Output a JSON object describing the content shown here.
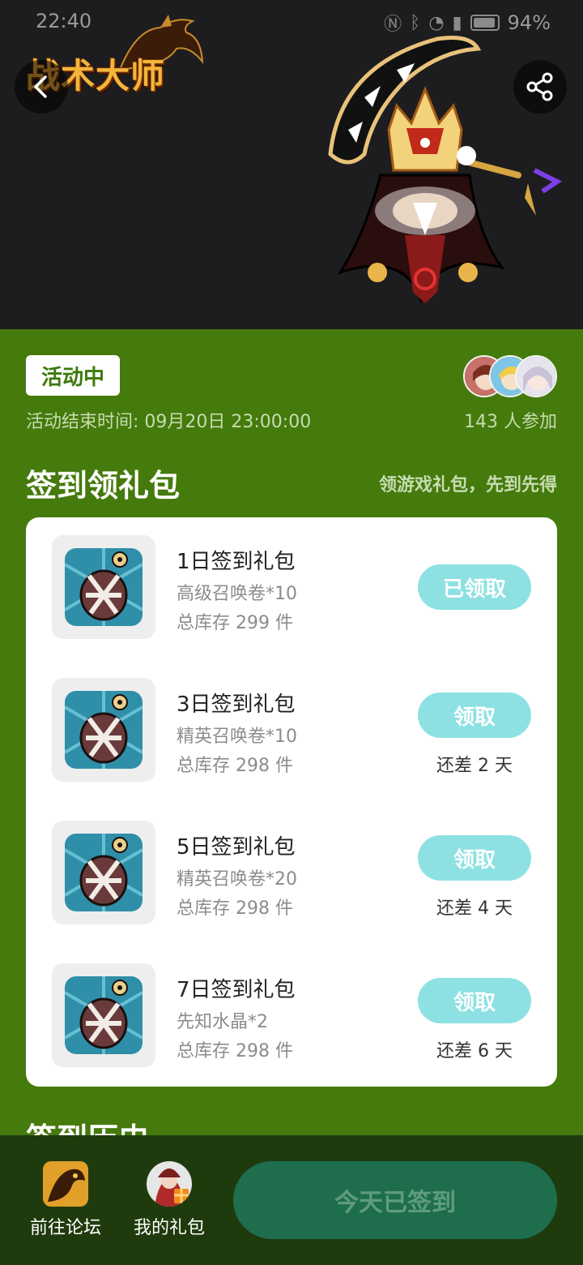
{
  "status_bar": {
    "time": "22:40",
    "battery": "94%"
  },
  "header": {
    "game_title": "战术大师"
  },
  "activity": {
    "status": "活动中",
    "end_time": "活动结束时间: 09月20日 23:00:00",
    "participants": "143 人参加"
  },
  "section": {
    "title": "签到领礼包",
    "hint": "领游戏礼包，先到先得"
  },
  "gifts": [
    {
      "title": "1日签到礼包",
      "content": "高级召唤卷*10",
      "stock": "总库存 299 件",
      "button": "已领取",
      "days_left": ""
    },
    {
      "title": "3日签到礼包",
      "content": "精英召唤卷*10",
      "stock": "总库存 298 件",
      "button": "领取",
      "days_left": "还差 2 天"
    },
    {
      "title": "5日签到礼包",
      "content": "精英召唤卷*20",
      "stock": "总库存 298 件",
      "button": "领取",
      "days_left": "还差 4 天"
    },
    {
      "title": "7日签到礼包",
      "content": "先知水晶*2",
      "stock": "总库存 298 件",
      "button": "领取",
      "days_left": "还差 6 天"
    }
  ],
  "next_section": {
    "title": "签到历史"
  },
  "bottom_bar": {
    "forum_label": "前往论坛",
    "gifts_label": "我的礼包",
    "signed_label": "今天已签到"
  },
  "colors": {
    "accent": "#457a0c",
    "button": "#8ee1e3",
    "signed": "#1e6e4e"
  }
}
